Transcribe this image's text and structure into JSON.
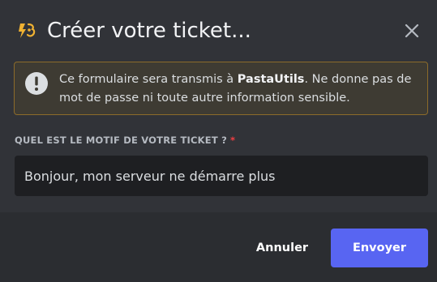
{
  "modal": {
    "title": "Créer votre ticket...",
    "icon": "app-logo-icon",
    "close_icon": "close-icon"
  },
  "notice": {
    "icon": "exclamation-circle-icon",
    "text_before": "Ce formulaire sera transmis à ",
    "app_name": "PastaUtils",
    "text_after": ". Ne donne pas de mot de passe ni toute autre information sensible."
  },
  "field": {
    "label": "QUEL EST LE MOTIF DE VOTRE TICKET ?",
    "required_marker": "*",
    "value": "Bonjour, mon serveur ne démarre plus"
  },
  "footer": {
    "cancel_label": "Annuler",
    "submit_label": "Envoyer"
  },
  "colors": {
    "background": "#313338",
    "footer": "#2b2d31",
    "input": "#1e1f22",
    "notice_bg": "#3e3b33",
    "notice_border": "#8c6b2a",
    "accent": "#5865f2",
    "required": "#f23f43",
    "logo": "#f0b232"
  }
}
